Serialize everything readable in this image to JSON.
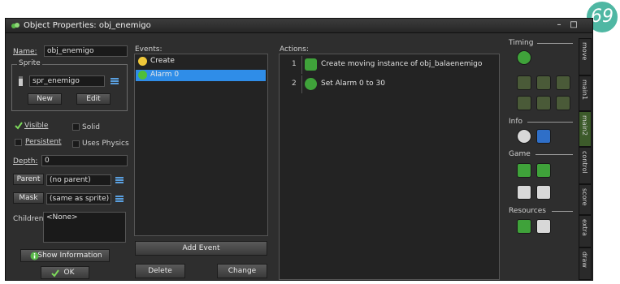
{
  "window": {
    "title": "Object Properties: obj_enemigo",
    "minimize_label": "–",
    "maximize_label": "□"
  },
  "badge": {
    "text": "69",
    "color": "#4fb7a3"
  },
  "properties": {
    "name_label": "Name:",
    "name_value": "obj_enemigo",
    "sprite_group_label": "Sprite",
    "sprite_value": "spr_enemigo",
    "new_button": "New",
    "edit_button": "Edit",
    "visible_label": "Visible",
    "solid_label": "Solid",
    "persistent_label": "Persistent",
    "uses_physics_label": "Uses Physics",
    "depth_label": "Depth:",
    "depth_value": "0",
    "parent_button": "Parent",
    "parent_value": "(no parent)",
    "mask_button": "Mask",
    "mask_value": "(same as sprite)",
    "children_label": "Children:",
    "children_value": "<None>",
    "show_info_button": "Show Information",
    "ok_button": "OK"
  },
  "events": {
    "label": "Events:",
    "items": [
      {
        "label": "Create",
        "icon": "lightbulb-icon",
        "selected": false
      },
      {
        "label": "Alarm 0",
        "icon": "alarm-clock-icon",
        "selected": true
      }
    ],
    "add_event_button": "Add Event",
    "delete_button": "Delete",
    "change_button": "Change"
  },
  "actions": {
    "label": "Actions:",
    "items": [
      {
        "number": "1",
        "label": "Create moving instance of obj_balaenemigo",
        "icon": "create-instance-icon"
      },
      {
        "number": "2",
        "label": "Set Alarm 0 to 30",
        "icon": "alarm-clock-icon"
      }
    ]
  },
  "palette": {
    "timing_label": "Timing",
    "info_label": "Info",
    "game_label": "Game",
    "resources_label": "Resources"
  },
  "tabs": [
    "move",
    "main1",
    "main2",
    "control",
    "score",
    "extra",
    "draw"
  ],
  "active_tab": "main2",
  "colors": {
    "window_bg": "#2e2e2e",
    "selection": "#2f8de8",
    "action_green": "#3fa23a"
  }
}
